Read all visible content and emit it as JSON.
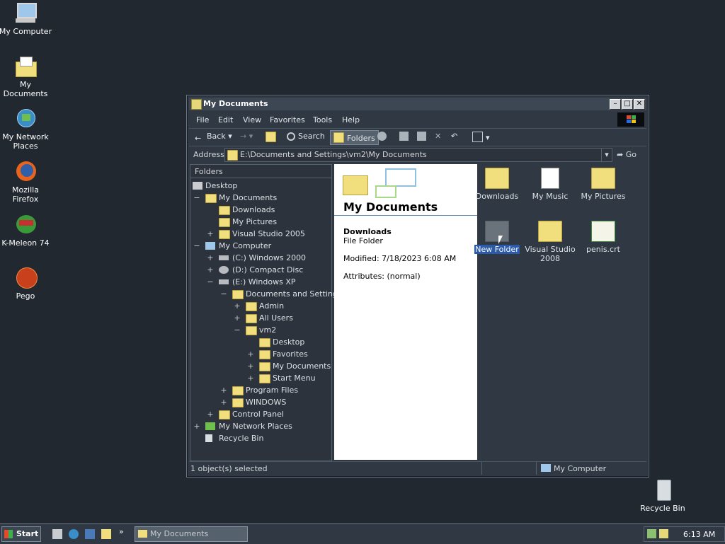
{
  "desktop": {
    "icons": [
      {
        "label": "My Computer"
      },
      {
        "label": "My Documents"
      },
      {
        "label": "My Network Places"
      },
      {
        "label": "Mozilla Firefox"
      },
      {
        "label": "K-Meleon 74"
      },
      {
        "label": "Pego"
      },
      {
        "label": "Recycle Bin"
      }
    ]
  },
  "window": {
    "title": "My Documents",
    "menu": [
      "File",
      "Edit",
      "View",
      "Favorites",
      "Tools",
      "Help"
    ],
    "toolbar": {
      "back": "Back",
      "search": "Search",
      "folders": "Folders"
    },
    "address_label": "Address",
    "address_value": "E:\\Documents and Settings\\vm2\\My Documents",
    "go": "Go",
    "folders_header": "Folders",
    "tree": [
      {
        "label": "Desktop",
        "exp": ""
      },
      {
        "label": "My Documents",
        "exp": "−"
      },
      {
        "label": "Downloads",
        "exp": ""
      },
      {
        "label": "My Pictures",
        "exp": ""
      },
      {
        "label": "Visual Studio 2005",
        "exp": "+"
      },
      {
        "label": "My Computer",
        "exp": "−"
      },
      {
        "label": "(C:) Windows 2000",
        "exp": "+"
      },
      {
        "label": "(D:) Compact Disc",
        "exp": "+"
      },
      {
        "label": "(E:) Windows XP",
        "exp": "−"
      },
      {
        "label": "Documents and Settings",
        "exp": "−"
      },
      {
        "label": "Admin",
        "exp": "+"
      },
      {
        "label": "All Users",
        "exp": "+"
      },
      {
        "label": "vm2",
        "exp": "−"
      },
      {
        "label": "Desktop",
        "exp": ""
      },
      {
        "label": "Favorites",
        "exp": "+"
      },
      {
        "label": "My Documents",
        "exp": "+"
      },
      {
        "label": "Start Menu",
        "exp": "+"
      },
      {
        "label": "Program Files",
        "exp": "+"
      },
      {
        "label": "WINDOWS",
        "exp": "+"
      },
      {
        "label": "Control Panel",
        "exp": "+"
      },
      {
        "label": "My Network Places",
        "exp": "+"
      },
      {
        "label": "Recycle Bin",
        "exp": ""
      }
    ],
    "info": {
      "title": "My Documents",
      "name": "Downloads",
      "type": "File Folder",
      "modified": "Modified: 7/18/2023 6:08 AM",
      "attributes": "Attributes: (normal)"
    },
    "files": [
      {
        "label": "Downloads"
      },
      {
        "label": "My Music"
      },
      {
        "label": "My Pictures"
      },
      {
        "label": "New Folder"
      },
      {
        "label": "Visual Studio 2008"
      },
      {
        "label": "penis.crt"
      }
    ],
    "status_left": "1 object(s) selected",
    "status_right": "My Computer"
  },
  "taskbar": {
    "start": "Start",
    "task": "My Documents",
    "clock": "6:13 AM"
  }
}
